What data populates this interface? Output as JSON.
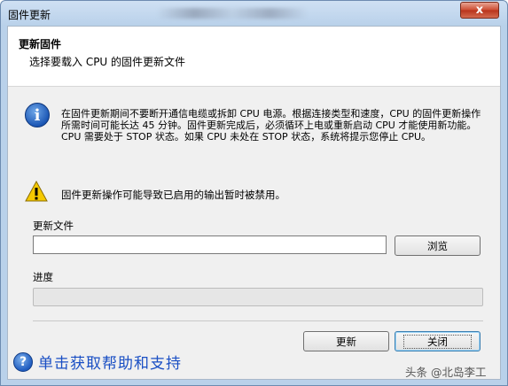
{
  "window": {
    "title": "固件更新",
    "close_symbol": "x"
  },
  "header": {
    "title": "更新固件",
    "subtitle": "选择要载入 CPU 的固件更新文件"
  },
  "info": {
    "icon": "info-icon",
    "text": "在固件更新期间不要断开通信电缆或拆卸 CPU 电源。根据连接类型和速度，CPU 的固件更新操作所需时间可能长达 45 分钟。固件更新完成后，必须循环上电或重新启动 CPU 才能使用新功能。CPU 需要处于 STOP 状态。如果 CPU 未处在 STOP 状态，系统将提示您停止 CPU。"
  },
  "warning": {
    "icon": "warning-icon",
    "text": "固件更新操作可能导致已启用的输出暂时被禁用。"
  },
  "file": {
    "label": "更新文件",
    "value": "",
    "browse_label": "浏览"
  },
  "progress": {
    "label": "进度",
    "percent": 0
  },
  "buttons": {
    "update_label": "更新",
    "close_label": "关闭"
  },
  "help": {
    "icon": "help-icon",
    "text": "单击获取帮助和支持"
  },
  "watermark": "头条 @北岛李工"
}
